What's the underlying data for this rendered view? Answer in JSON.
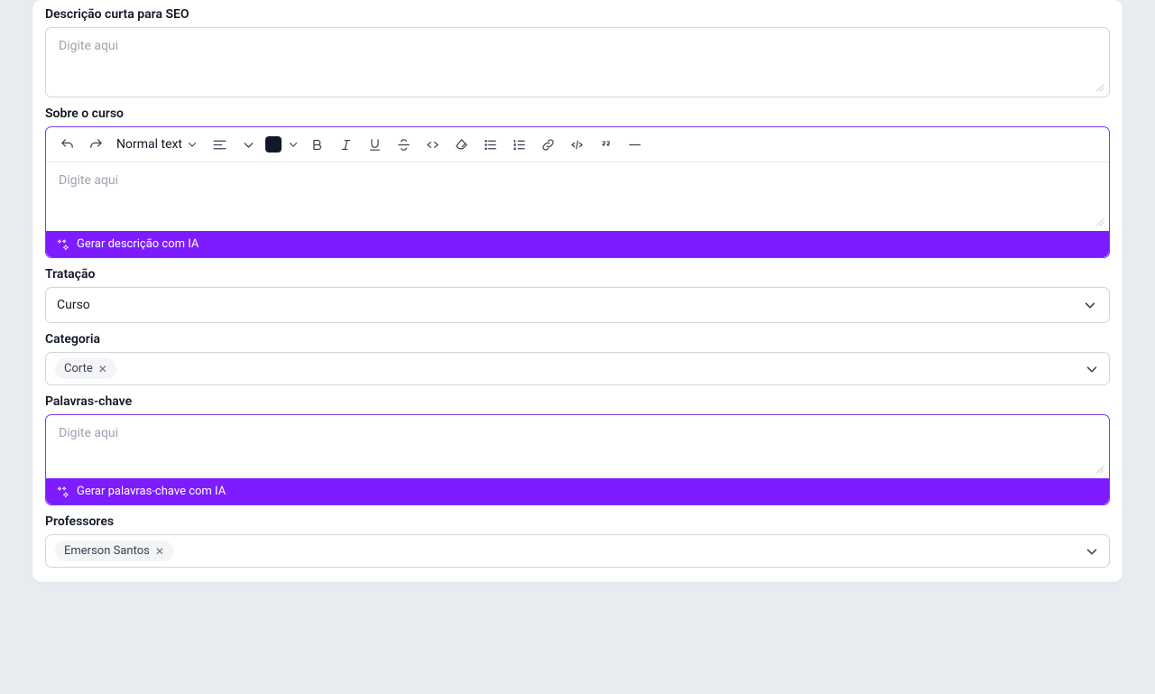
{
  "seo": {
    "label": "Descrição curta para SEO",
    "placeholder": "Digite aqui"
  },
  "about": {
    "label": "Sobre o curso",
    "placeholder": "Digite aqui",
    "heading_label": "Normal text",
    "ai_label": "Gerar descrição com IA"
  },
  "tratacao": {
    "label": "Tratação",
    "value": "Curso"
  },
  "categoria": {
    "label": "Categoria",
    "tags": [
      "Corte"
    ]
  },
  "keywords": {
    "label": "Palavras-chave",
    "placeholder": "Digite aqui",
    "ai_label": "Gerar palavras-chave com IA"
  },
  "professores": {
    "label": "Professores",
    "tags": [
      "Emerson Santos"
    ]
  }
}
